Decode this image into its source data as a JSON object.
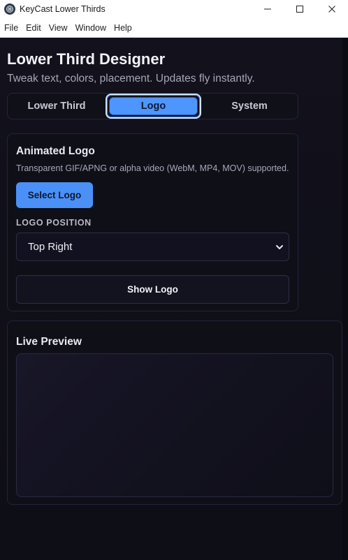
{
  "window": {
    "title": "KeyCast Lower Thirds",
    "icon": "app-logo-icon",
    "controls": [
      "minimize-icon",
      "maximize-icon",
      "close-icon"
    ]
  },
  "menu": [
    "File",
    "Edit",
    "View",
    "Window",
    "Help"
  ],
  "header": {
    "title": "Lower Third Designer",
    "subtitle": "Tweak text, colors, placement. Updates fly instantly."
  },
  "tabs": [
    {
      "label": "Lower Third",
      "active": false
    },
    {
      "label": "Logo",
      "active": true
    },
    {
      "label": "System",
      "active": false
    }
  ],
  "logo_card": {
    "title": "Animated Logo",
    "description": "Transparent GIF/APNG or alpha video (WebM, MP4, MOV) supported.",
    "select_button": "Select Logo",
    "position_label": "LOGO POSITION",
    "position_value": "Top Right",
    "show_button": "Show Logo"
  },
  "preview": {
    "title": "Live Preview"
  },
  "colors": {
    "accent": "#4f95ff",
    "background": "#0e0e17",
    "card_border": "#23233a"
  }
}
